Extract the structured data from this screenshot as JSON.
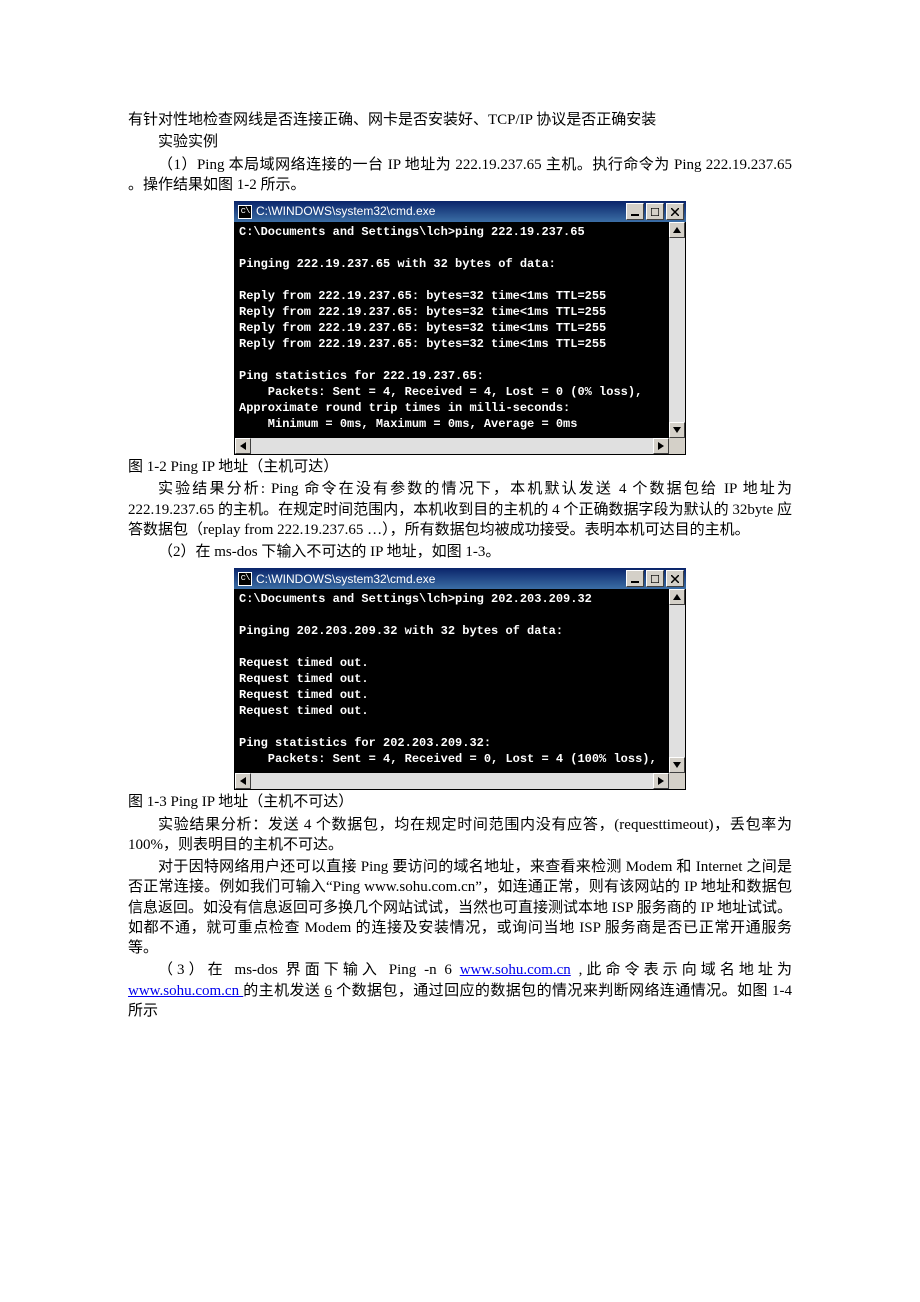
{
  "para0": "有针对性地检查网线是否连接正确、网卡是否安装好、TCP/IP 协议是否正确安装",
  "para1": "实验实例",
  "para2": "（1）Ping 本局域网络连接的一台 IP 地址为 222.19.237.65 主机。执行命令为 Ping 222.19.237.65 。操作结果如图 1-2 所示。",
  "cmd1": {
    "title": "C:\\WINDOWS\\system32\\cmd.exe",
    "icon": "c\\",
    "lines": [
      "C:\\Documents and Settings\\lch>ping 222.19.237.65",
      "",
      "Pinging 222.19.237.65 with 32 bytes of data:",
      "",
      "Reply from 222.19.237.65: bytes=32 time<1ms TTL=255",
      "Reply from 222.19.237.65: bytes=32 time<1ms TTL=255",
      "Reply from 222.19.237.65: bytes=32 time<1ms TTL=255",
      "Reply from 222.19.237.65: bytes=32 time<1ms TTL=255",
      "",
      "Ping statistics for 222.19.237.65:",
      "    Packets: Sent = 4, Received = 4, Lost = 0 (0% loss),",
      "Approximate round trip times in milli-seconds:",
      "    Minimum = 0ms, Maximum = 0ms, Average = 0ms"
    ]
  },
  "caption1": "图 1-2 Ping IP 地址（主机可达）",
  "para3": "实验结果分析: Ping 命令在没有参数的情况下，本机默认发送 4 个数据包给 IP 地址为 222.19.237.65 的主机。在规定时间范围内，本机收到目的主机的 4 个正确数据字段为默认的 32byte 应答数据包（replay from 222.19.237.65 …），所有数据包均被成功接受。表明本机可达目的主机。",
  "para4": "（2）在 ms-dos 下输入不可达的 IP 地址，如图 1-3。",
  "cmd2": {
    "title": "C:\\WINDOWS\\system32\\cmd.exe",
    "icon": "c\\",
    "lines": [
      "C:\\Documents and Settings\\lch>ping 202.203.209.32",
      "",
      "Pinging 202.203.209.32 with 32 bytes of data:",
      "",
      "Request timed out.",
      "Request timed out.",
      "Request timed out.",
      "Request timed out.",
      "",
      "Ping statistics for 202.203.209.32:",
      "    Packets: Sent = 4, Received = 0, Lost = 4 (100% loss),"
    ]
  },
  "caption2": "图 1-3 Ping IP 地址（主机不可达）",
  "para5": "实验结果分析：发送 4 个数据包，均在规定时间范围内没有应答，(requesttimeout)，丢包率为 100%，则表明目的主机不可达。",
  "para6": "对于因特网络用户还可以直接 Ping 要访问的域名地址，来查看来检测 Modem 和 Internet 之间是否正常连接。例如我们可输入“Ping www.sohu.com.cn”，如连通正常，则有该网站的 IP 地址和数据包信息返回。如没有信息返回可多换几个网站试试，当然也可直接测试本地 ISP 服务商的 IP 地址试试。如都不通，就可重点检查 Modem 的连接及安装情况，或询问当地 ISP 服务商是否已正常开通服务等。",
  "para7a": "（3）在 ms-dos 界面下输入 Ping  -n 6 ",
  "link1": "www.sohu.com.cn",
  "para7b": " ,此命令表示向域名地址为 ",
  "link2": "www.sohu.com.cn ",
  "para7c": "的主机发送 ",
  "para7d_ul": "6",
  "para7e": " 个数据包，通过回应的数据包的情况来判断网络连通情况。如图 1-4 所示"
}
